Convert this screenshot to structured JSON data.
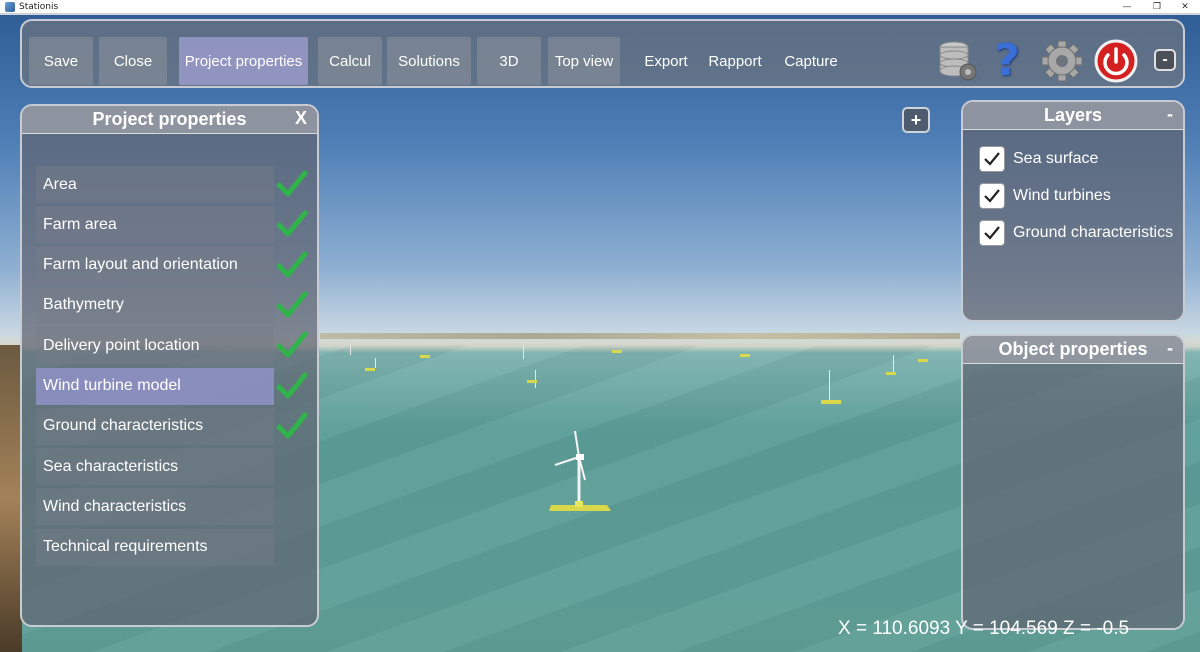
{
  "window": {
    "title": "Stationis",
    "minimize": "—",
    "restore": "❐",
    "close": "✕"
  },
  "toolbar": {
    "buttons": [
      {
        "label": "Save",
        "state": "boxed"
      },
      {
        "label": "Close",
        "state": "boxed"
      },
      {
        "label": "Project properties",
        "state": "active"
      },
      {
        "label": "Calcul",
        "state": "boxed"
      },
      {
        "label": "Solutions",
        "state": "boxed"
      },
      {
        "label": "3D",
        "state": "boxed"
      },
      {
        "label": "Top view",
        "state": "boxed"
      },
      {
        "label": "Export",
        "state": "plain"
      },
      {
        "label": "Rapport",
        "state": "plain"
      },
      {
        "label": "Capture",
        "state": "plain"
      }
    ],
    "icons": [
      "database-gear-icon",
      "help-icon",
      "settings-gear-icon",
      "power-icon",
      "minimize-icon"
    ],
    "help_glyph": "?",
    "minimize_glyph": "-"
  },
  "project_panel": {
    "title": "Project properties",
    "close_label": "X",
    "items": [
      {
        "label": "Area",
        "checked": true
      },
      {
        "label": "Farm area",
        "checked": true
      },
      {
        "label": "Farm layout and orientation",
        "checked": true
      },
      {
        "label": "Bathymetry",
        "checked": true
      },
      {
        "label": "Delivery point location",
        "checked": true
      },
      {
        "label": "Wind turbine model",
        "checked": true,
        "selected": true
      },
      {
        "label": "Ground characteristics",
        "checked": true
      },
      {
        "label": "Sea characteristics",
        "checked": false
      },
      {
        "label": "Wind characteristics",
        "checked": false
      },
      {
        "label": "Technical requirements",
        "checked": false
      }
    ]
  },
  "layers_panel": {
    "title": "Layers",
    "collapse_label": "-",
    "layers": [
      {
        "label": "Sea surface",
        "checked": true
      },
      {
        "label": "Wind turbines",
        "checked": true
      },
      {
        "label": "Ground characteristics",
        "checked": true
      }
    ]
  },
  "object_panel": {
    "title": "Object properties",
    "collapse_label": "-"
  },
  "view": {
    "add_label": "+"
  },
  "coordinates": {
    "text": "X = 110.6093 Y = 104.569 Z = -0.5"
  },
  "colors": {
    "check_green": "#2fb34a",
    "power_red": "#d42020",
    "help_blue": "#3a6fd8",
    "buoy_yellow": "#d8d84a"
  }
}
